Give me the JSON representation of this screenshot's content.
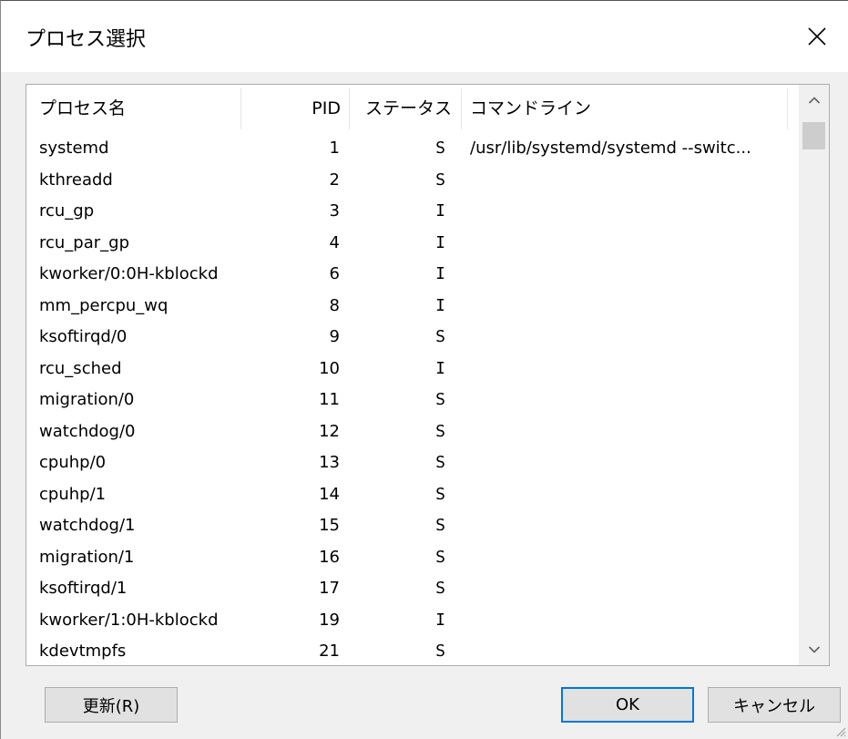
{
  "window": {
    "title": "プロセス選択",
    "close_label": "✕"
  },
  "table": {
    "columns": {
      "name": "プロセス名",
      "pid": "PID",
      "status": "ステータス",
      "command": "コマンドライン"
    },
    "rows": [
      {
        "name": "systemd",
        "pid": "1",
        "status": "S",
        "command": "/usr/lib/systemd/systemd --switc..."
      },
      {
        "name": "kthreadd",
        "pid": "2",
        "status": "S",
        "command": ""
      },
      {
        "name": "rcu_gp",
        "pid": "3",
        "status": "I",
        "command": ""
      },
      {
        "name": "rcu_par_gp",
        "pid": "4",
        "status": "I",
        "command": ""
      },
      {
        "name": "kworker/0:0H-kblockd",
        "pid": "6",
        "status": "I",
        "command": ""
      },
      {
        "name": "mm_percpu_wq",
        "pid": "8",
        "status": "I",
        "command": ""
      },
      {
        "name": "ksoftirqd/0",
        "pid": "9",
        "status": "S",
        "command": ""
      },
      {
        "name": "rcu_sched",
        "pid": "10",
        "status": "I",
        "command": ""
      },
      {
        "name": "migration/0",
        "pid": "11",
        "status": "S",
        "command": ""
      },
      {
        "name": "watchdog/0",
        "pid": "12",
        "status": "S",
        "command": ""
      },
      {
        "name": "cpuhp/0",
        "pid": "13",
        "status": "S",
        "command": ""
      },
      {
        "name": "cpuhp/1",
        "pid": "14",
        "status": "S",
        "command": ""
      },
      {
        "name": "watchdog/1",
        "pid": "15",
        "status": "S",
        "command": ""
      },
      {
        "name": "migration/1",
        "pid": "16",
        "status": "S",
        "command": ""
      },
      {
        "name": "ksoftirqd/1",
        "pid": "17",
        "status": "S",
        "command": ""
      },
      {
        "name": "kworker/1:0H-kblockd",
        "pid": "19",
        "status": "I",
        "command": ""
      },
      {
        "name": "kdevtmpfs",
        "pid": "21",
        "status": "S",
        "command": ""
      }
    ]
  },
  "buttons": {
    "refresh": "更新(R)",
    "ok": "OK",
    "cancel": "キャンセル"
  },
  "colors": {
    "background": "#f0f0f0",
    "focus_border": "#0078d7"
  },
  "icons": {
    "close": "close-icon",
    "scroll_up": "chevron-up-icon",
    "scroll_down": "chevron-down-icon"
  }
}
